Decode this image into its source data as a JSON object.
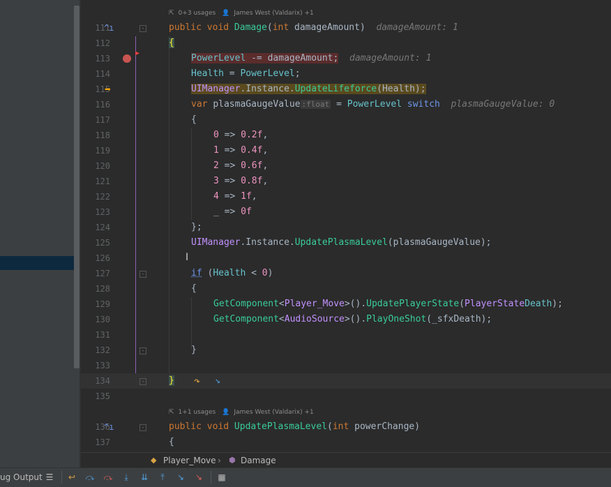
{
  "annotations": [
    {
      "usages": "0+3 usages",
      "author": "James West (Valdarix) +1"
    },
    {
      "usages": "1+1 usages",
      "author": "James West (Valdarix) +1"
    }
  ],
  "lines": [
    {
      "n": "111"
    },
    {
      "n": "112"
    },
    {
      "n": "113"
    },
    {
      "n": "114"
    },
    {
      "n": "115"
    },
    {
      "n": "116"
    },
    {
      "n": "117"
    },
    {
      "n": "118"
    },
    {
      "n": "119"
    },
    {
      "n": "120"
    },
    {
      "n": "121"
    },
    {
      "n": "122"
    },
    {
      "n": "123"
    },
    {
      "n": "124"
    },
    {
      "n": "125"
    },
    {
      "n": "126"
    },
    {
      "n": "127"
    },
    {
      "n": "128"
    },
    {
      "n": "129"
    },
    {
      "n": "130"
    },
    {
      "n": "131"
    },
    {
      "n": "132"
    },
    {
      "n": "133"
    },
    {
      "n": "134"
    },
    {
      "n": "135"
    },
    {
      "n": "136"
    },
    {
      "n": "137"
    }
  ],
  "code": {
    "l111": {
      "a": "public void ",
      "b": "Damage",
      "c": "(",
      "d": "int ",
      "e": "damageAmount)",
      "hint": "damageAmount: 1"
    },
    "l112": "{",
    "l113": {
      "a": "PowerLevel",
      "b": " -= damageAmount;",
      "hint": "damageAmount: 1"
    },
    "l114": {
      "a": "Health",
      "b": " = ",
      "c": "PowerLevel",
      ";": ";"
    },
    "l115": {
      "a": "UIManager",
      "b": ".Instance.",
      "c": "UpdateLifeforce",
      "d": "(Health);"
    },
    "l116": {
      "a": "var ",
      "b": "plasmaGaugeValue",
      "type": ":float",
      "c": " = ",
      "d": "PowerLevel",
      "e": " switch",
      "hint": "plasmaGaugeValue: 0"
    },
    "l117": "{",
    "l118": {
      "a": "0",
      "b": " => ",
      "c": "0.2f",
      ",": ","
    },
    "l119": {
      "a": "1",
      "b": " => ",
      "c": "0.4f",
      ",": ","
    },
    "l120": {
      "a": "2",
      "b": " => ",
      "c": "0.6f",
      ",": ","
    },
    "l121": {
      "a": "3",
      "b": " => ",
      "c": "0.8f",
      ",": ","
    },
    "l122": {
      "a": "4",
      "b": " => ",
      "c": "1f",
      ",": ","
    },
    "l123": {
      "a": "_",
      "b": " => ",
      "c": "0f"
    },
    "l124": "};",
    "l125": {
      "a": "UIManager",
      "b": ".Instance.",
      "c": "UpdatePlasmaLevel",
      "d": "(plasmaGaugeValue);"
    },
    "l127": {
      "a": "if",
      "b": " (",
      "c": "Health",
      " <": " < ",
      "d": "0",
      ")": ")"
    },
    "l128": "{",
    "l129": {
      "a": "GetComponent",
      "b": "<",
      "c": "Player_Move",
      "d": ">().",
      "e": "UpdatePlayerState",
      "f": "(",
      "g": "PlayerState",
      ".": ".",
      "h": "Death",
      ");": ");"
    },
    "l130": {
      "a": "GetComponent",
      "b": "<",
      "c": "AudioSource",
      "d": ">().",
      "e": "PlayOneShot",
      "f": "(_sfxDeath);"
    },
    "l132": "}",
    "l134": "}",
    "l136": {
      "a": "public void ",
      "b": "UpdatePlasmaLevel",
      "c": "(",
      "d": "int ",
      "e": "powerChange)"
    },
    "l137": "{"
  },
  "breadcrumb": {
    "class": "Player_Move",
    "method": "Damage"
  },
  "toolbar": {
    "label": "ug Output"
  },
  "colors": {
    "accent": "#ffa500",
    "breakpoint": "#c75450",
    "bg": "#2b2b2b"
  }
}
